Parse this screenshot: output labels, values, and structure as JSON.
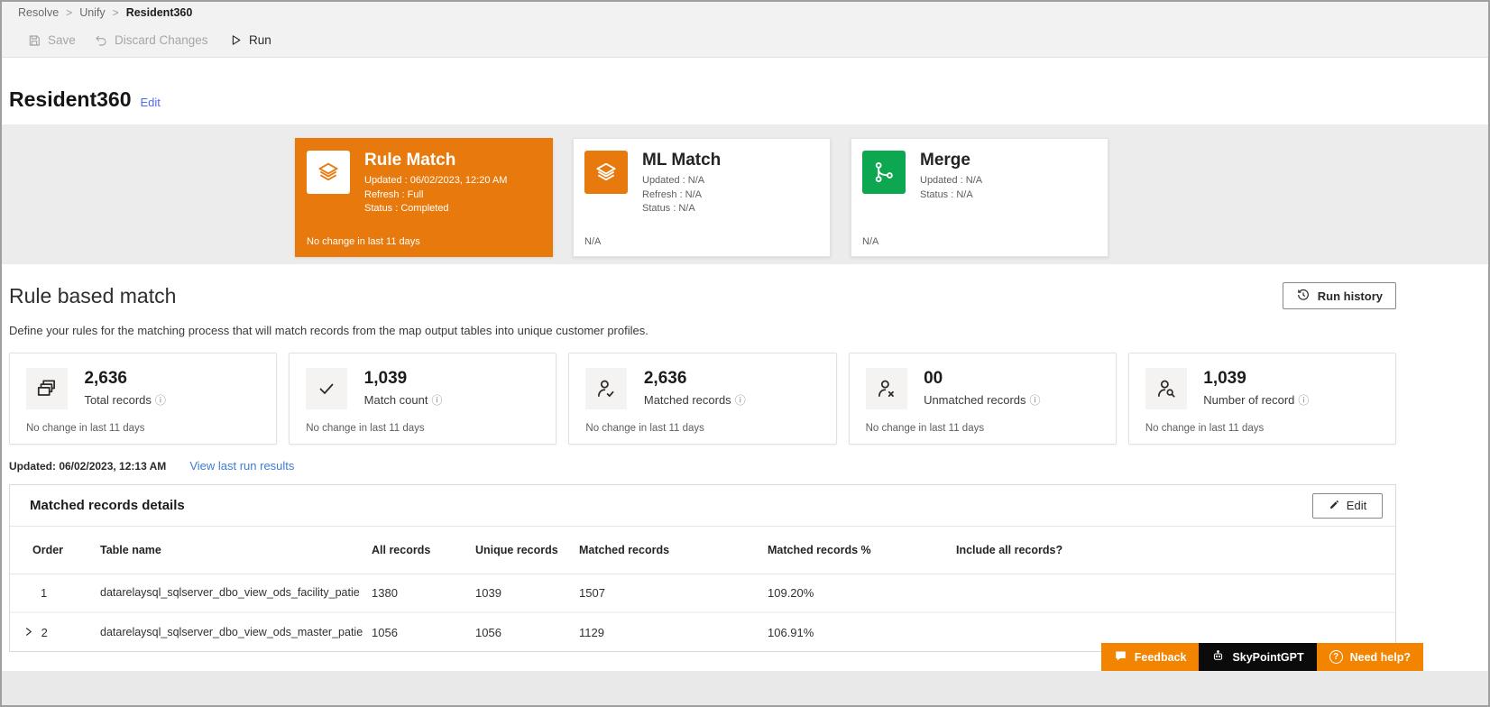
{
  "breadcrumb": {
    "items": [
      "Resolve",
      "Unify",
      "Resident360"
    ],
    "separator": ">"
  },
  "toolbar": {
    "save_label": "Save",
    "discard_label": "Discard Changes",
    "run_label": "Run"
  },
  "page": {
    "title": "Resident360",
    "edit_label": "Edit"
  },
  "process_cards": [
    {
      "name": "Rule Match",
      "line1": "Updated : 06/02/2023, 12:20 AM",
      "line2": "Refresh : Full",
      "line3": "Status : Completed",
      "footer": "No change in last 11 days"
    },
    {
      "name": "ML Match",
      "line1": "Updated : N/A",
      "line2": "Refresh : N/A",
      "line3": "Status : N/A",
      "footer": "N/A"
    },
    {
      "name": "Merge",
      "line1": "Updated : N/A",
      "line2": "Status : N/A",
      "line3": "",
      "footer": "N/A"
    }
  ],
  "section": {
    "title": "Rule based match",
    "run_history_label": "Run history",
    "description": "Define your rules for the matching process that will match records from the map output tables into unique customer profiles."
  },
  "stats": [
    {
      "value": "2,636",
      "label": "Total records",
      "footer": "No change in last 11 days"
    },
    {
      "value": "1,039",
      "label": "Match count",
      "footer": "No change in last 11 days"
    },
    {
      "value": "2,636",
      "label": "Matched records",
      "footer": "No change in last 11 days"
    },
    {
      "value": "00",
      "label": "Unmatched records",
      "footer": "No change in last 11 days"
    },
    {
      "value": "1,039",
      "label": "Number of record",
      "footer": "No change in last 11 days"
    }
  ],
  "last_run": {
    "updated": "Updated: 06/02/2023, 12:13 AM",
    "link": "View last run results"
  },
  "details_panel": {
    "title": "Matched records details",
    "edit_label": "Edit",
    "columns": [
      "Order",
      "Table name",
      "All records",
      "Unique records",
      "Matched records",
      "Matched records %",
      "Include all records?"
    ],
    "rows": [
      {
        "order": "1",
        "table": "datarelaysql_sqlserver_dbo_view_ods_facility_patie",
        "all": "1380",
        "unique": "1039",
        "matched": "1507",
        "pct": "109.20%"
      },
      {
        "order": "2",
        "table": "datarelaysql_sqlserver_dbo_view_ods_master_patie",
        "all": "1056",
        "unique": "1056",
        "matched": "1129",
        "pct": "106.91%"
      }
    ]
  },
  "floating_buttons": {
    "feedback": "Feedback",
    "gpt": "SkyPointGPT",
    "help": "Need help?"
  },
  "icons": {
    "info": "ⓘ"
  },
  "colors": {
    "accent_orange": "#E87A0D",
    "merge_green": "#0CA750",
    "link_blue": "#4F6BED",
    "link_blue2": "#3E7CD3",
    "button_orange": "#F28400",
    "gpt_black": "#0b0b0b"
  }
}
